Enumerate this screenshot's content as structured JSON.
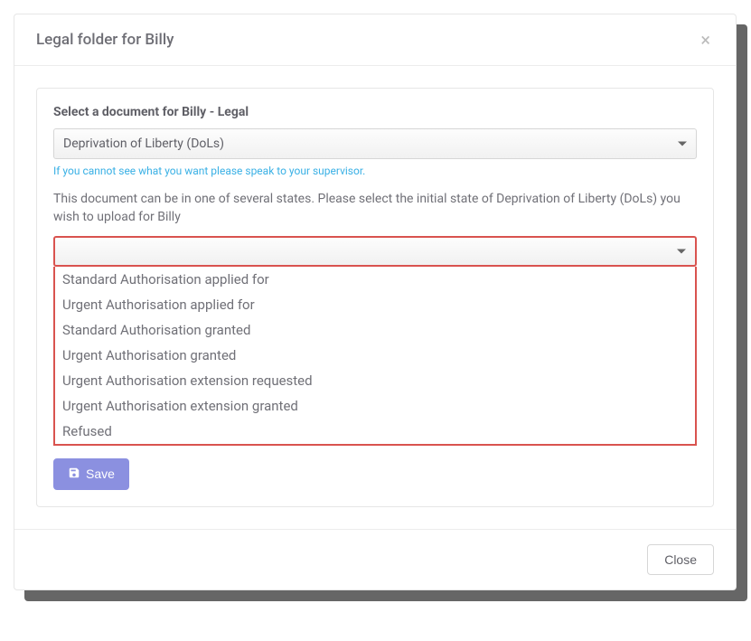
{
  "header": {
    "title": "Legal folder for Billy"
  },
  "card": {
    "section_label": "Select a document for Billy - Legal",
    "doc_select_value": "Deprivation of Liberty (DoLs)",
    "helper_text": "If you cannot see what you want please speak to your supervisor.",
    "info_text": "This document can be in one of several states. Please select the initial state of Deprivation of Liberty (DoLs) you wish to upload for Billy",
    "state_select_value": "",
    "state_options": [
      "Standard Authorisation applied for",
      "Urgent Authorisation applied for",
      "Standard Authorisation granted",
      "Urgent Authorisation granted",
      "Urgent Authorisation extension requested",
      "Urgent Authorisation extension granted",
      "Refused"
    ],
    "save_label": "Save"
  },
  "footer": {
    "close_label": "Close"
  }
}
